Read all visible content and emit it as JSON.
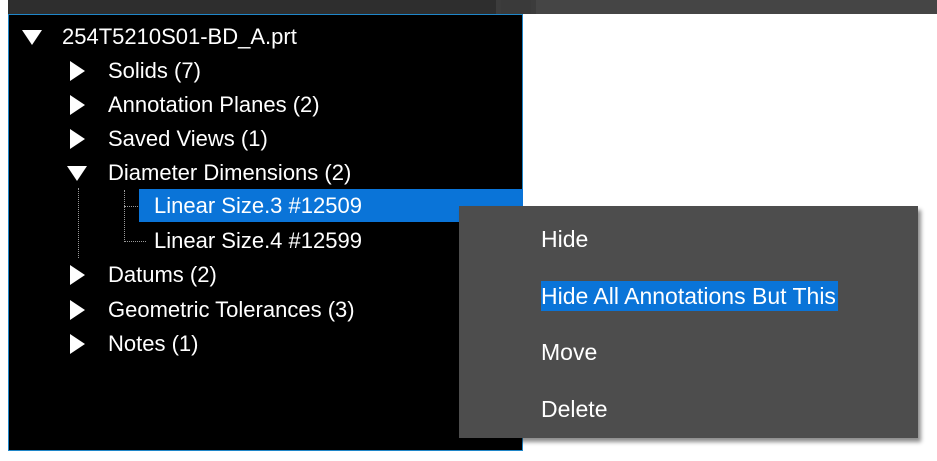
{
  "tree": {
    "root": {
      "label": "254T5210S01-BD_A.prt",
      "expanded": true
    },
    "items": [
      {
        "label": "Solids (7)",
        "expanded": false
      },
      {
        "label": "Annotation Planes (2)",
        "expanded": false
      },
      {
        "label": "Saved Views (1)",
        "expanded": false
      },
      {
        "label": "Diameter Dimensions (2)",
        "expanded": true,
        "children": [
          {
            "label": "Linear Size.3 #12509",
            "selected": true
          },
          {
            "label": "Linear Size.4 #12599",
            "selected": false
          }
        ]
      },
      {
        "label": "Datums (2)",
        "expanded": false
      },
      {
        "label": "Geometric Tolerances (3)",
        "expanded": false
      },
      {
        "label": "Notes (1)",
        "expanded": false
      }
    ]
  },
  "context_menu": {
    "items": [
      {
        "label": "Hide",
        "highlighted": false
      },
      {
        "label": "Hide All Annotations But This",
        "highlighted": true
      },
      {
        "label": "Move",
        "highlighted": false
      },
      {
        "label": "Delete",
        "highlighted": false
      }
    ]
  },
  "colors": {
    "tree_background": "#000000",
    "selection": "#0a74d8",
    "menu_background": "#4d4d4d",
    "panel_border": "#1f86c8",
    "text": "#ffffff"
  },
  "icons": {
    "expanded": "triangle-down-icon",
    "collapsed": "triangle-right-icon"
  }
}
